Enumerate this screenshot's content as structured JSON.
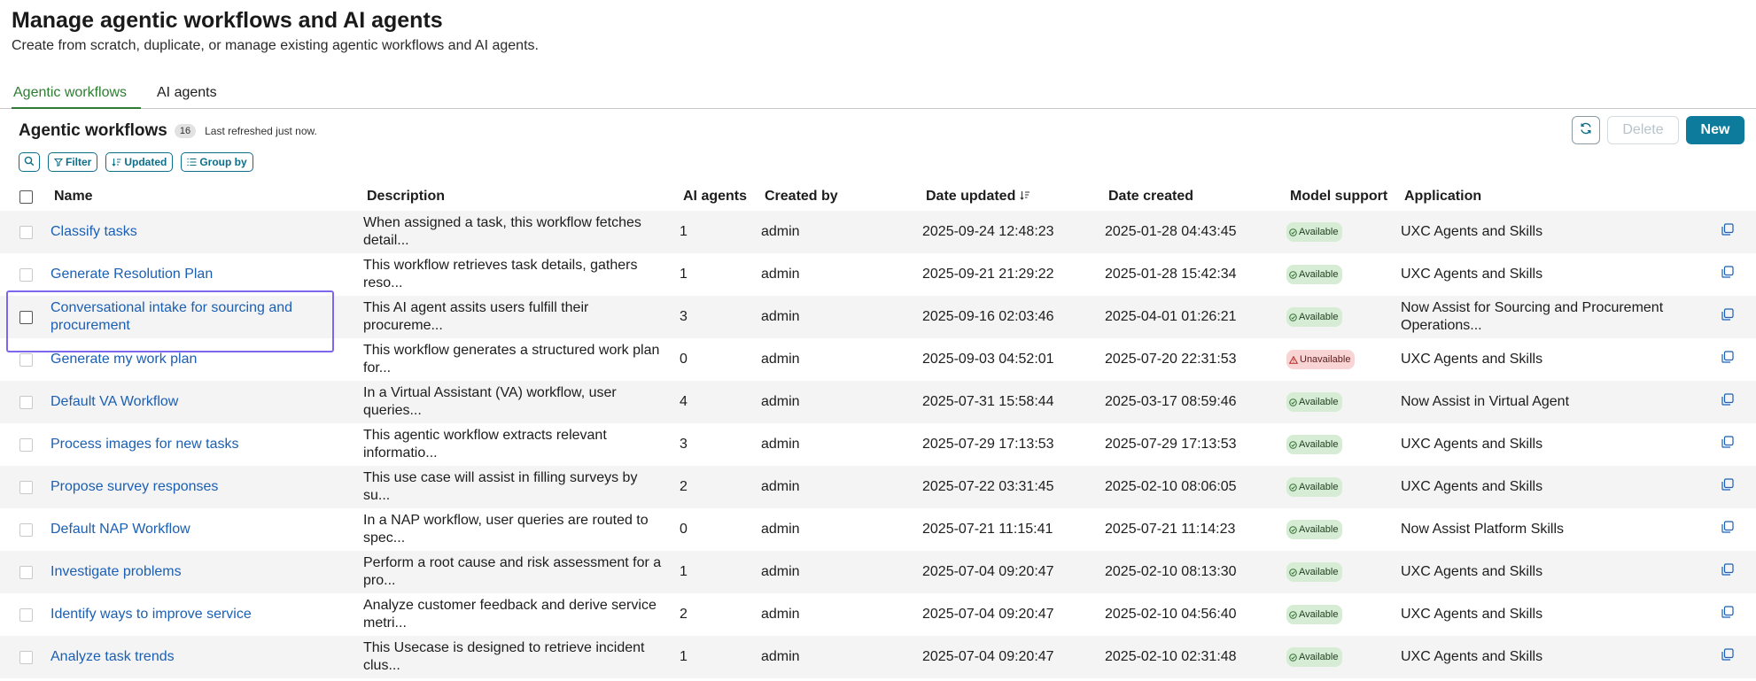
{
  "header": {
    "title": "Manage agentic workflows and AI agents",
    "subtitle": "Create from scratch, duplicate, or manage existing agentic workflows and AI agents."
  },
  "tabs": [
    {
      "label": "Agentic workflows",
      "active": true
    },
    {
      "label": "AI agents",
      "active": false
    }
  ],
  "list": {
    "title": "Agentic workflows",
    "count": "16",
    "refreshed": "Last refreshed just now."
  },
  "actions": {
    "delete_label": "Delete",
    "new_label": "New"
  },
  "toolbar": {
    "filter_label": "Filter",
    "sort_label": "Updated",
    "group_label": "Group by"
  },
  "columns": {
    "name": "Name",
    "description": "Description",
    "ai_agents": "AI agents",
    "created_by": "Created by",
    "date_updated": "Date updated",
    "date_created": "Date created",
    "model_support": "Model support",
    "application": "Application"
  },
  "colors": {
    "accent_tab": "#2e7d32",
    "link": "#1b5fb4",
    "primary_button": "#0d7c9c",
    "available_badge": "#d7ecd4",
    "unavailable_badge": "#f9d4d4",
    "highlight": "#7b68ee"
  },
  "rows": [
    {
      "name": "Classify tasks",
      "description": "When assigned a task, this workflow fetches detail...",
      "agents": "1",
      "created_by": "admin",
      "updated": "2025-09-24 12:48:23",
      "created": "2025-01-28 04:43:45",
      "model": "Available",
      "application": "UXC Agents and Skills"
    },
    {
      "name": "Generate Resolution Plan",
      "description": "This workflow retrieves task details, gathers reso...",
      "agents": "1",
      "created_by": "admin",
      "updated": "2025-09-21 21:29:22",
      "created": "2025-01-28 15:42:34",
      "model": "Available",
      "application": "UXC Agents and Skills"
    },
    {
      "name": "Conversational intake for sourcing and procurement",
      "description": "This AI agent assits users fulfill their procureme...",
      "agents": "3",
      "created_by": "admin",
      "updated": "2025-09-16 02:03:46",
      "created": "2025-04-01 01:26:21",
      "model": "Available",
      "application": "Now Assist for Sourcing and Procurement Operations..."
    },
    {
      "name": "Generate my work plan",
      "description": "This workflow generates a structured work plan for...",
      "agents": "0",
      "created_by": "admin",
      "updated": "2025-09-03 04:52:01",
      "created": "2025-07-20 22:31:53",
      "model": "Unavailable",
      "application": "UXC Agents and Skills"
    },
    {
      "name": "Default VA Workflow",
      "description": "In a Virtual Assistant (VA) workflow, user queries...",
      "agents": "4",
      "created_by": "admin",
      "updated": "2025-07-31 15:58:44",
      "created": "2025-03-17 08:59:46",
      "model": "Available",
      "application": "Now Assist in Virtual Agent"
    },
    {
      "name": "Process images for new tasks",
      "description": "This agentic workflow extracts relevant informatio...",
      "agents": "3",
      "created_by": "admin",
      "updated": "2025-07-29 17:13:53",
      "created": "2025-07-29 17:13:53",
      "model": "Available",
      "application": "UXC Agents and Skills"
    },
    {
      "name": "Propose survey responses",
      "description": "This use case will assist in filling surveys by su...",
      "agents": "2",
      "created_by": "admin",
      "updated": "2025-07-22 03:31:45",
      "created": "2025-02-10 08:06:05",
      "model": "Available",
      "application": "UXC Agents and Skills"
    },
    {
      "name": "Default NAP Workflow",
      "description": "In a NAP workflow, user queries are routed to spec...",
      "agents": "0",
      "created_by": "admin",
      "updated": "2025-07-21 11:15:41",
      "created": "2025-07-21 11:14:23",
      "model": "Available",
      "application": "Now Assist Platform Skills"
    },
    {
      "name": "Investigate problems",
      "description": "Perform a root cause and risk assessment for a pro...",
      "agents": "1",
      "created_by": "admin",
      "updated": "2025-07-04 09:20:47",
      "created": "2025-02-10 08:13:30",
      "model": "Available",
      "application": "UXC Agents and Skills"
    },
    {
      "name": "Identify ways to improve service",
      "description": "Analyze customer feedback and derive service metri...",
      "agents": "2",
      "created_by": "admin",
      "updated": "2025-07-04 09:20:47",
      "created": "2025-02-10 04:56:40",
      "model": "Available",
      "application": "UXC Agents and Skills"
    },
    {
      "name": "Analyze task trends",
      "description": "This Usecase is designed to retrieve incident clus...",
      "agents": "1",
      "created_by": "admin",
      "updated": "2025-07-04 09:20:47",
      "created": "2025-02-10 02:31:48",
      "model": "Available",
      "application": "UXC Agents and Skills"
    }
  ]
}
